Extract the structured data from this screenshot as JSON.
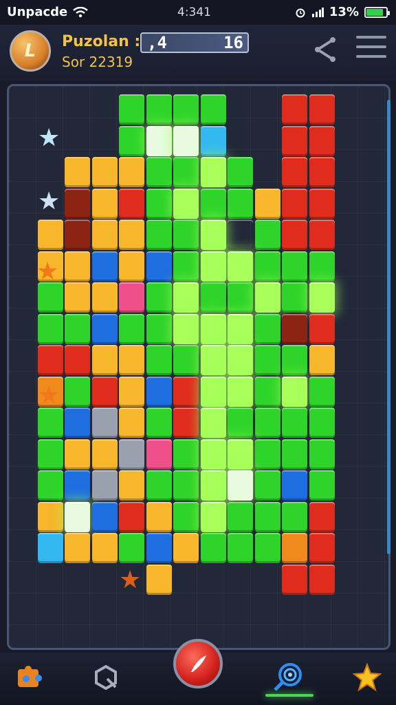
{
  "status_bar": {
    "carrier": "Unpacde",
    "time": "4:341",
    "battery_text": "13%",
    "battery_level": 0.85
  },
  "header": {
    "avatar_letter": "L",
    "title": "Puzolan :",
    "subtitle": "Sor 22319",
    "score_left": ",4",
    "score_right": "16"
  },
  "colors": {
    "green": "#2fd42a",
    "lime": "#a8ff5a",
    "yellow": "#f7b62b",
    "orange": "#f08a1c",
    "red": "#e02c1c",
    "darkred": "#8c2414",
    "blue": "#1f6ee0",
    "cyan": "#34b8f2",
    "pink": "#f0508a",
    "gray": "#9aa0ad",
    "white": "#e8fbe0",
    "dark": "#2a3a2a"
  },
  "board": {
    "rows": [
      "....GGGG..RR.",
      "....GwWC..RR.",
      "..YYYGGlG.RR.",
      "..DYRGlGGYRR.",
      ".YDYYGGlcGRR.",
      ".YYBYBGllGGG.",
      ".GYYPGlGGlGl.",
      ".GGBGGlllGDR.",
      ".RRYYGGllGGY.",
      ".OGRYBRllGlG.",
      ".GBgYGRlGGGG.",
      ".GYYgPGllGGG.",
      ".GBgYGGlwGBG.",
      ".YwBRYGlGGGR.",
      ".CYYGBYGGGOR.",
      ".....Y....RR."
    ]
  },
  "stars": [
    {
      "glyph": "★",
      "color": "#bfe6ff"
    },
    {
      "glyph": "★",
      "color": "#cfe0f5"
    },
    {
      "glyph": "★",
      "color": "#f07a1a"
    },
    {
      "glyph": "★",
      "color": "#f07a1a"
    },
    {
      "glyph": "★",
      "color": "#d9601a"
    }
  ],
  "bottom_nav": {
    "left_icon": "puzzle-icon",
    "second_icon": "search-refresh-icon",
    "center_icon": "play-feather-icon",
    "fourth_icon": "target-icon",
    "right_icon": "star-icon"
  }
}
